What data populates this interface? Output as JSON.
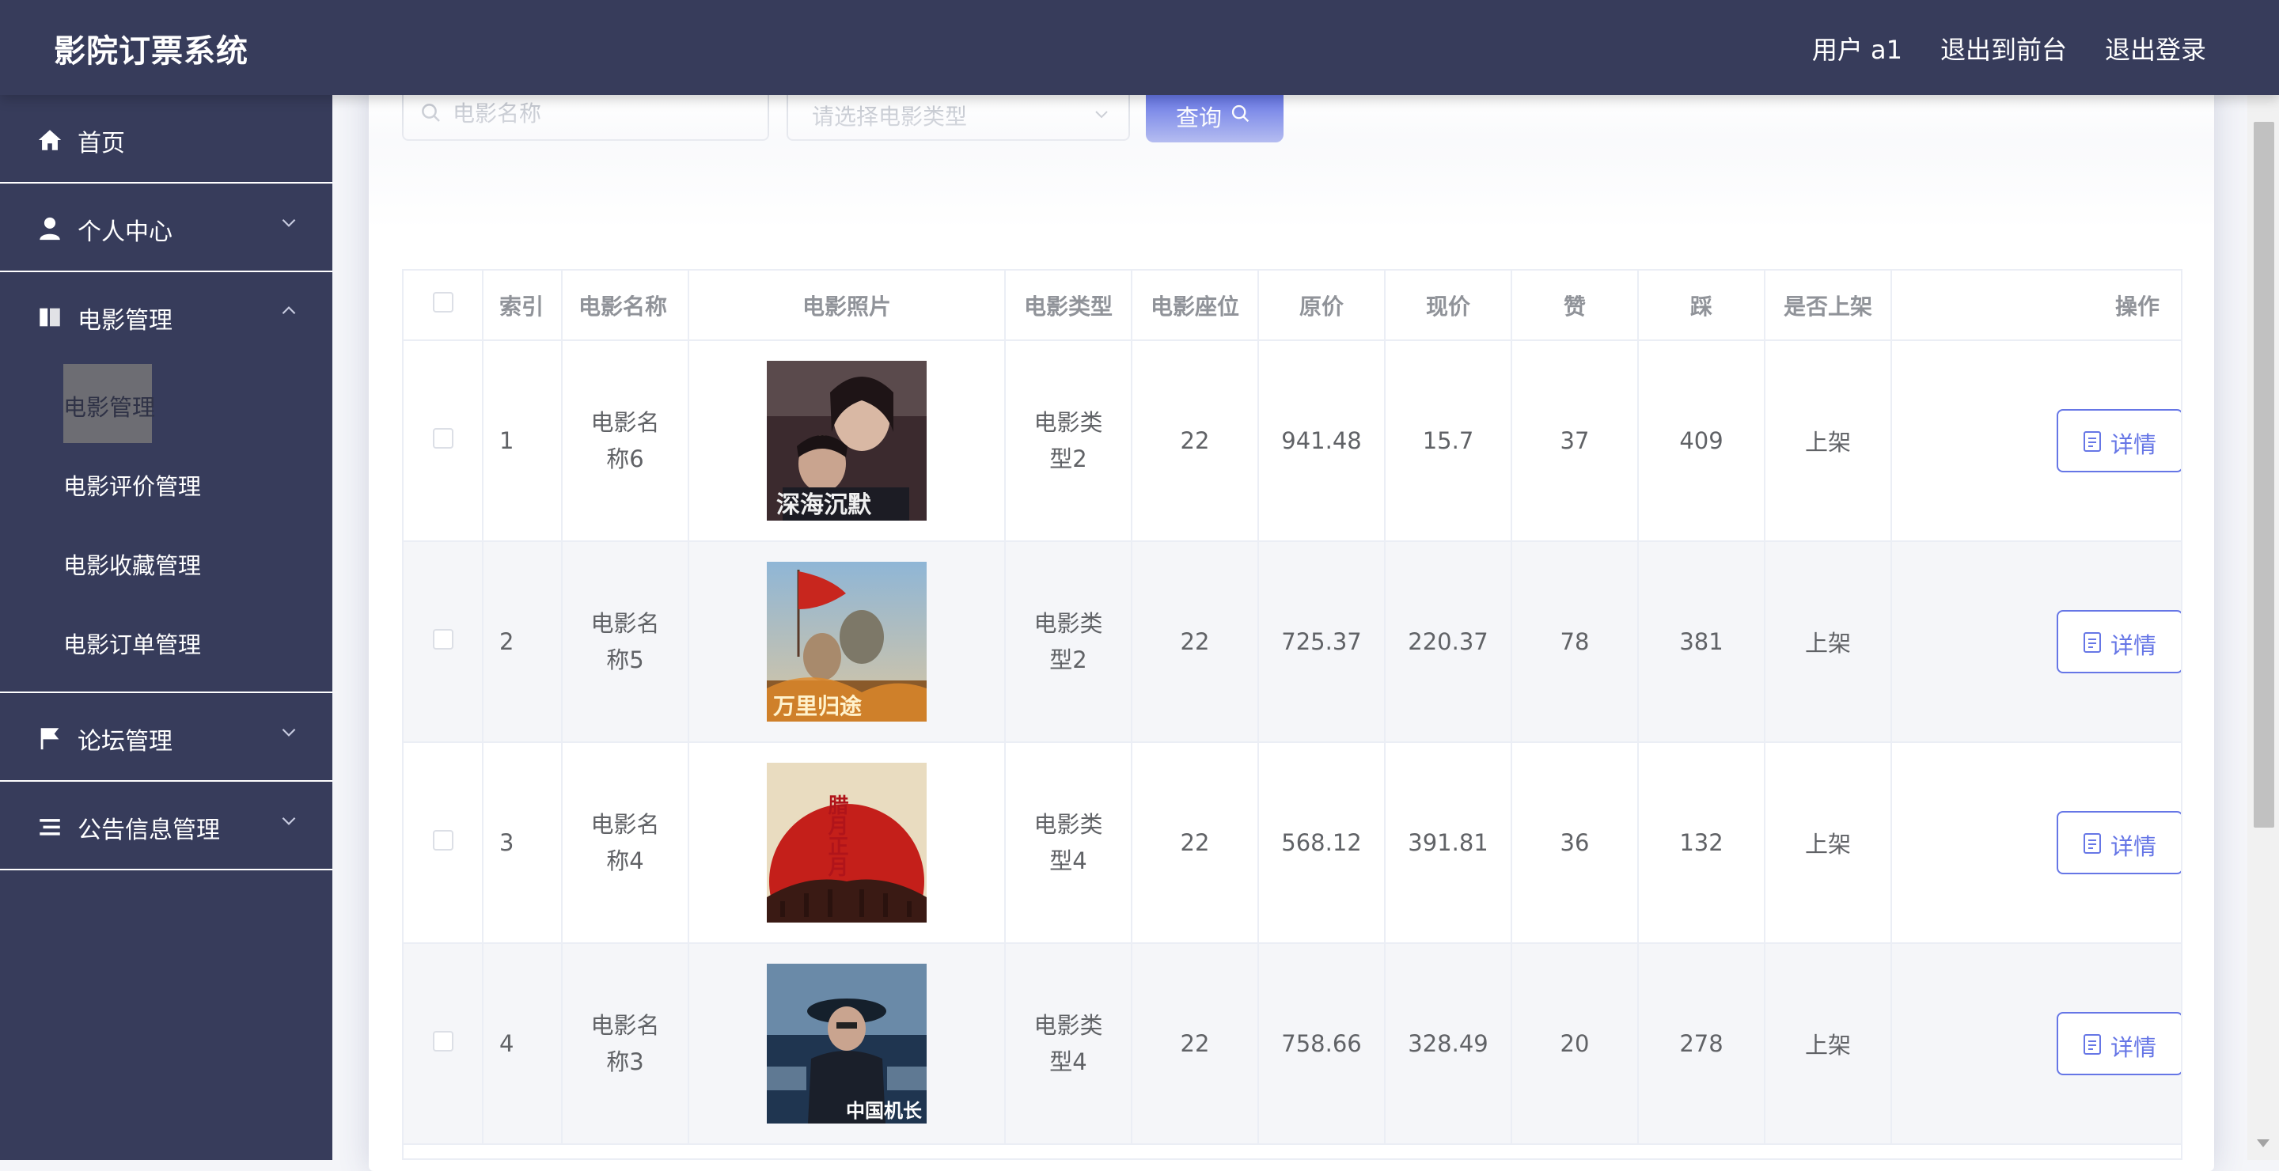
{
  "header": {
    "app_title": "影院订票系统",
    "user_label": "用户 a1",
    "front_link": "退出到前台",
    "logout_link": "退出登录"
  },
  "sidebar": {
    "home": "首页",
    "personal_center": "个人中心",
    "movie_management": "电影管理",
    "movie_sub": [
      "电影管理",
      "电影评价管理",
      "电影收藏管理",
      "电影订单管理"
    ],
    "forum_management": "论坛管理",
    "notice_management": "公告信息管理"
  },
  "search": {
    "name_placeholder": "电影名称",
    "type_placeholder": "请选择电影类型",
    "query_button": "查询"
  },
  "table": {
    "headers": [
      "索引",
      "电影名称",
      "电影照片",
      "电影类型",
      "电影座位",
      "原价",
      "现价",
      "赞",
      "踩",
      "是否上架",
      "操作"
    ],
    "detail_label": "详情",
    "rows": [
      {
        "index": "1",
        "name": "电影名称6",
        "type": "电影类型2",
        "seats": "22",
        "original_price": "941.48",
        "current_price": "15.7",
        "likes": "37",
        "dislikes": "409",
        "on_shelf": "上架"
      },
      {
        "index": "2",
        "name": "电影名称5",
        "type": "电影类型2",
        "seats": "22",
        "original_price": "725.37",
        "current_price": "220.37",
        "likes": "78",
        "dislikes": "381",
        "on_shelf": "上架"
      },
      {
        "index": "3",
        "name": "电影名称4",
        "type": "电影类型4",
        "seats": "22",
        "original_price": "568.12",
        "current_price": "391.81",
        "likes": "36",
        "dislikes": "132",
        "on_shelf": "上架"
      },
      {
        "index": "4",
        "name": "电影名称3",
        "type": "电影类型4",
        "seats": "22",
        "original_price": "758.66",
        "current_price": "328.49",
        "likes": "20",
        "dislikes": "278",
        "on_shelf": "上架"
      }
    ]
  },
  "posters": [
    {
      "subject": "poster-1",
      "text": "深海沉默"
    },
    {
      "subject": "poster-2",
      "text": "万里归途"
    },
    {
      "subject": "poster-3",
      "text": "腊月正月"
    },
    {
      "subject": "poster-4",
      "text": "中国机长"
    }
  ],
  "colors": {
    "sidebar_bg": "#373c5b",
    "accent": "#6676e6",
    "page_bg": "#f4f5f9"
  }
}
